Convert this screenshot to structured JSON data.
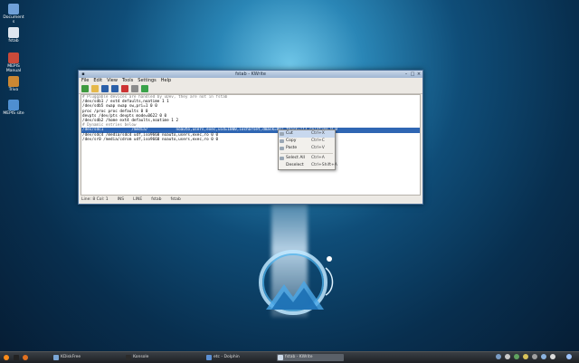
{
  "desktop": {
    "icons": [
      {
        "label": "Document s",
        "color": "#6fa0d8"
      },
      {
        "label": "fstab",
        "color": "#dfe6ef"
      },
      {
        "label": "MEPIS Manual",
        "color": "#c94a3a"
      },
      {
        "label": "Trivo",
        "color": "#cc8833"
      },
      {
        "label": "MEPIS site",
        "color": "#4f8fd0"
      }
    ]
  },
  "window": {
    "title": "fstab - KWrite",
    "menu": [
      "File",
      "Edit",
      "View",
      "Tools",
      "Settings",
      "Help"
    ],
    "toolbar": [
      "new-icon",
      "open-icon",
      "save-icon",
      "save-as-icon",
      "close-icon",
      "undo-icon",
      "redo-icon"
    ],
    "editor_lines": [
      {
        "text": "# Pluggable devices are handled by uDev, they are not in fstab",
        "comment": true
      },
      {
        "text": "/dev/sdb1 / ext4 defaults,noatime 1 1"
      },
      {
        "text": "/dev/sdb5 swap swap sw,pri=1 0 0"
      },
      {
        "text": "proc /proc proc defaults 0 0"
      },
      {
        "text": "devpts /dev/pts devpts mode=0622 0 0"
      },
      {
        "text": "/dev/sdb2 /home ext4 defaults,noatime 1 2"
      },
      {
        "text": "# Dynamic entries below",
        "comment": true
      },
      {
        "text": "/dev/sdc1            /media/            noauto,users,exec,uid=1000,iocharset,dmask=002,fmask=113,relatime 0 0",
        "selected": true
      },
      {
        "text": "/dev/sdc4 /media/sdc4 udf,iso9660 noauto,users,exec,ro 0 0"
      },
      {
        "text": "/dev/sr0 /media/cdrom udf,iso9660 noauto,users,exec,ro 0 0"
      }
    ],
    "status": {
      "position": "Line: 8 Col: 1",
      "mode": "INS",
      "encoding": "LINE",
      "filetype": "fstab",
      "filename": "fstab"
    }
  },
  "context_menu": {
    "items": [
      {
        "label": "Cut",
        "shortcut": "Ctrl+X",
        "highlight": true,
        "icon": "cut-icon"
      },
      {
        "label": "Copy",
        "shortcut": "Ctrl+C",
        "icon": "copy-icon"
      },
      {
        "label": "Paste",
        "shortcut": "Ctrl+V",
        "icon": "paste-icon"
      },
      {
        "label": "Select All",
        "shortcut": "Ctrl+A",
        "icon": "select-all-icon"
      },
      {
        "label": "Deselect",
        "shortcut": "Ctrl+Shift+A",
        "icon": ""
      }
    ]
  },
  "taskbar": {
    "tasks": [
      {
        "label": "KDiskFree",
        "color": "#7aa6d6",
        "active": false
      },
      {
        "label": "Konsole",
        "color": "#2b2b2b",
        "active": false
      },
      {
        "label": "etc - Dolphin",
        "color": "#5b8fd3",
        "active": false
      },
      {
        "label": "fstab - KWrite",
        "color": "#ccd9e8",
        "active": true
      }
    ]
  },
  "colors": {
    "selection": "#2f66b3",
    "menu_highlight": "#c8d8ee"
  }
}
